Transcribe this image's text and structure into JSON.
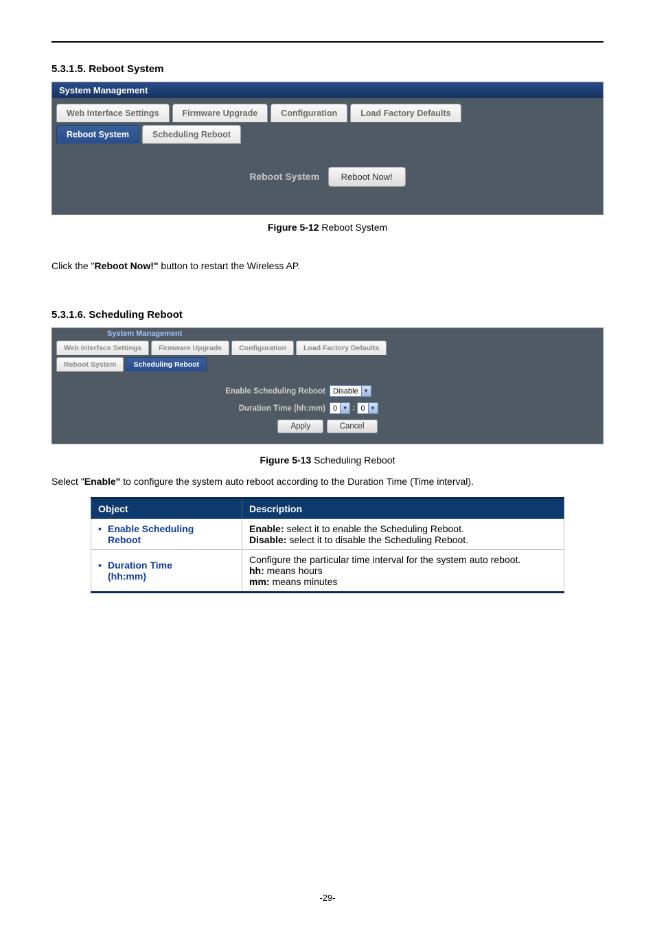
{
  "section1": {
    "num": "5.3.1.5.",
    "title": "Reboot System"
  },
  "panel1": {
    "title": "System Management",
    "tabs_row1": [
      "Web Interface Settings",
      "Firmware Upgrade",
      "Configuration",
      "Load Factory Defaults"
    ],
    "tabs_row2": {
      "active": "Reboot System",
      "other": "Scheduling Reboot"
    },
    "reboot_label": "Reboot System",
    "reboot_button": "Reboot Now!"
  },
  "caption1": {
    "prefix": "Figure 5-12",
    "text": " Reboot System"
  },
  "para1": {
    "pre": "Click the \"",
    "bold": "Reboot Now!\"",
    "post": " button to restart the Wireless AP."
  },
  "section2": {
    "num": "5.3.1.6.",
    "title": "Scheduling Reboot"
  },
  "panel2": {
    "title": "System Management",
    "tabs_row1": [
      "Web Interface Settings",
      "Firmware Upgrade",
      "Configuration",
      "Load Factory Defaults"
    ],
    "tabs_row2": {
      "other": "Reboot System",
      "active": "Scheduling Reboot"
    },
    "enable_label": "Enable Scheduling Reboot",
    "enable_value": "Disable",
    "duration_label": "Duration Time (hh:mm)",
    "hh": "0",
    "mm": "0",
    "apply": "Apply",
    "cancel": "Cancel"
  },
  "caption2": {
    "prefix": "Figure 5-13",
    "text": " Scheduling Reboot"
  },
  "para2": {
    "pre": "Select \"",
    "bold": "Enable\"",
    "post": " to configure the system auto reboot according to the Duration Time (Time interval)."
  },
  "table": {
    "headers": [
      "Object",
      "Description"
    ],
    "rows": [
      {
        "obj_lines": [
          "Enable Scheduling",
          "Reboot"
        ],
        "desc": [
          {
            "b": "Enable:",
            "t": " select it to enable the Scheduling Reboot."
          },
          {
            "b": "Disable:",
            "t": " select it to disable the Scheduling Reboot."
          }
        ]
      },
      {
        "obj_lines": [
          "Duration Time",
          "(hh:mm)"
        ],
        "desc": [
          {
            "b": "",
            "t": "Configure the particular time interval for the system auto reboot."
          },
          {
            "b": "hh:",
            "t": " means hours"
          },
          {
            "b": "mm:",
            "t": " means minutes"
          }
        ]
      }
    ]
  },
  "page_number": "-29-"
}
